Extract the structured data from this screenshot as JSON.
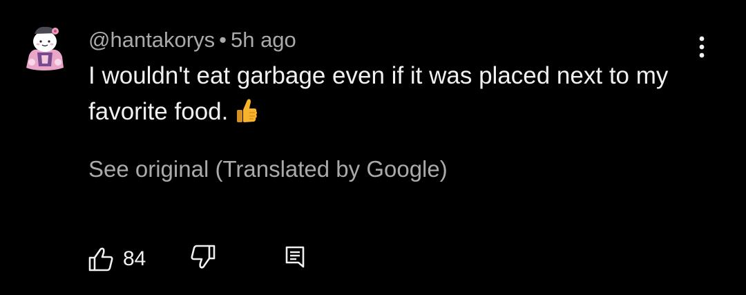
{
  "comment": {
    "author": "@hantakorys",
    "separator": "•",
    "time": "5h ago",
    "text": "I wouldn't eat garbage even if it was placed next to my favorite food.",
    "emoji": "thumbs-up-emoji",
    "translation_link": "See original (Translated by Google)"
  },
  "actions": {
    "like_icon": "thumbs-up-outline-icon",
    "like_count": "84",
    "dislike_icon": "thumbs-down-outline-icon",
    "reply_icon": "reply-comment-icon",
    "more_icon": "more-vertical-icon"
  },
  "colors": {
    "background": "#000000",
    "primary_text": "#f1f1f1",
    "secondary_text": "#aaaaaa"
  }
}
